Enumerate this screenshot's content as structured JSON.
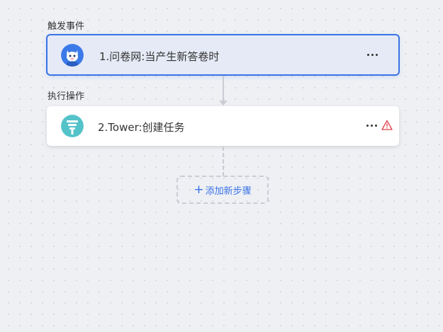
{
  "sections": {
    "trigger_label": "触发事件",
    "action_label": "执行操作"
  },
  "steps": [
    {
      "title": "1.问卷网:当产生新答卷时",
      "icon": "wenjuan-mascot-icon",
      "selected": true
    },
    {
      "title": "2.Tower:创建任务",
      "icon": "tower-icon",
      "warning": true
    }
  ],
  "add_step": {
    "plus": "+",
    "label": "添加新步骤"
  },
  "colors": {
    "accent": "#3a73e6",
    "trigger_icon_bg": "#3b7ae8",
    "tower_icon_bg": "#54c3c9",
    "warning": "#e0404a"
  }
}
